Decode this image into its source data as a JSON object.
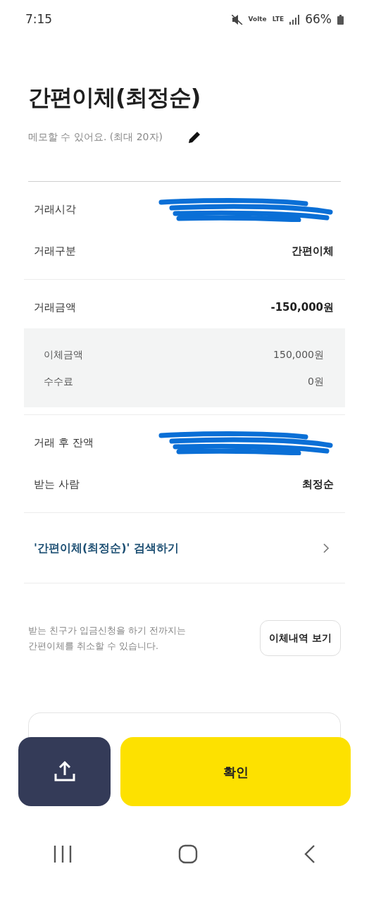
{
  "status_bar": {
    "time": "7:15",
    "network_labels": [
      "Volte",
      "LTE"
    ],
    "battery": "66%"
  },
  "title": "간편이체(최정순)",
  "memo": {
    "placeholder": "메모할 수 있어요. (최대 20자)"
  },
  "sections": [
    {
      "rows": [
        {
          "label": "거래시각",
          "value": null,
          "redacted": true
        },
        {
          "label": "거래구분",
          "value": "간편이체",
          "redacted": false
        }
      ]
    },
    {
      "rows": [
        {
          "label": "거래금액",
          "value": "-150,000원",
          "redacted": false
        }
      ],
      "details": [
        {
          "label": "이체금액",
          "value": "150,000원"
        },
        {
          "label": "수수료",
          "value": "0원"
        }
      ]
    },
    {
      "rows": [
        {
          "label": "거래 후 잔액",
          "value": null,
          "redacted": true
        },
        {
          "label": "받는 사람",
          "value": "최정순",
          "redacted": false
        }
      ]
    }
  ],
  "search_link": "'간편이체(최정순)' 검색하기",
  "notice": "받는 친구가 입금신청을 하기 전까지는 간편이체를 취소할 수 있습니다.",
  "history_button": "이체내역 보기",
  "confirm_button": "확인"
}
